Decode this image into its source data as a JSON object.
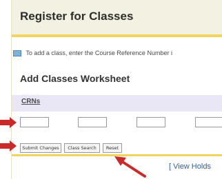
{
  "page": {
    "title": "Register for Classes",
    "info_text": "To add a class, enter the Course Reference Number i",
    "section_title": "Add Classes Worksheet"
  },
  "crn": {
    "header": "CRNs",
    "inputs": [
      "",
      "",
      "",
      ""
    ]
  },
  "buttons": {
    "submit_label": "Submit Changes",
    "class_search_label": "Class Search",
    "reset_label": "Reset"
  },
  "links": {
    "view_holds": "[ View Holds"
  },
  "colors": {
    "accent_yellow": "#f2d35c",
    "arrow_red": "#c92a2a",
    "crn_header_bg": "#e9e7f6",
    "link_blue": "#2f5da8"
  }
}
